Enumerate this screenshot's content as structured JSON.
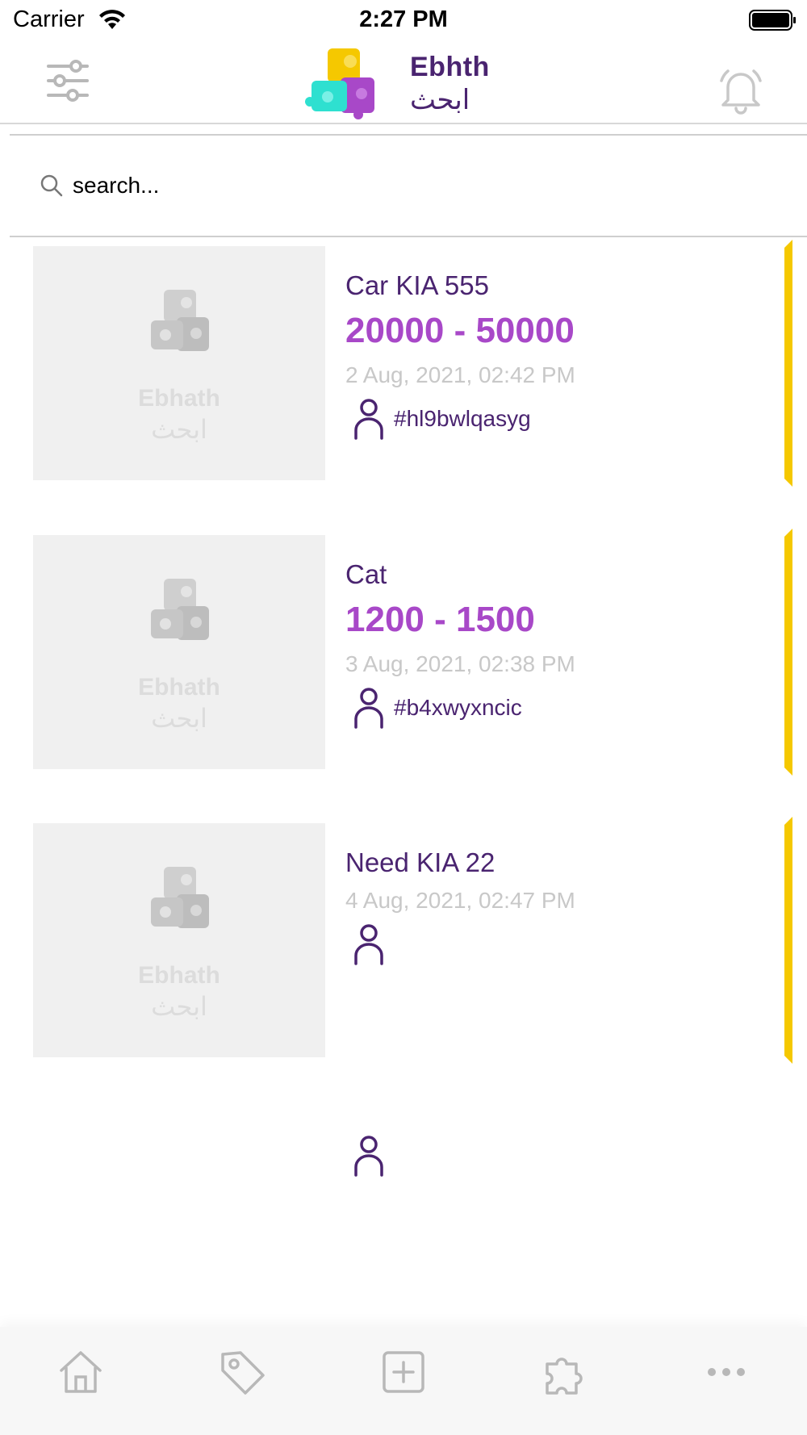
{
  "status_bar": {
    "carrier": "Carrier",
    "time": "2:27 PM"
  },
  "app": {
    "name_en": "Ebhth",
    "name_ar": "ابحث"
  },
  "search": {
    "placeholder": "search..."
  },
  "thumb_placeholder": {
    "name_en": "Ebhath",
    "name_ar": "ابحث"
  },
  "listings": [
    {
      "title": "Car KIA 555",
      "price": "20000 - 50000",
      "date": "2 Aug, 2021, 02:42 PM",
      "user_id": "#hl9bwlqasyg"
    },
    {
      "title": "Cat",
      "price": "1200 - 1500",
      "date": "3 Aug, 2021, 02:38 PM",
      "user_id": "#b4xwyxncic"
    },
    {
      "title": "Need KIA 22",
      "price": "",
      "date": "4 Aug, 2021, 02:47 PM",
      "user_id": ""
    }
  ],
  "tabs": [
    "home-icon",
    "tag-icon",
    "add-square-icon",
    "puzzle-icon",
    "more-icon"
  ],
  "colors": {
    "brand_purple": "#4a2470",
    "price_purple": "#a848c8",
    "accent_yellow": "#f5c800",
    "muted_gray": "#c8c8c8",
    "icon_gray": "#b8b8b8"
  }
}
